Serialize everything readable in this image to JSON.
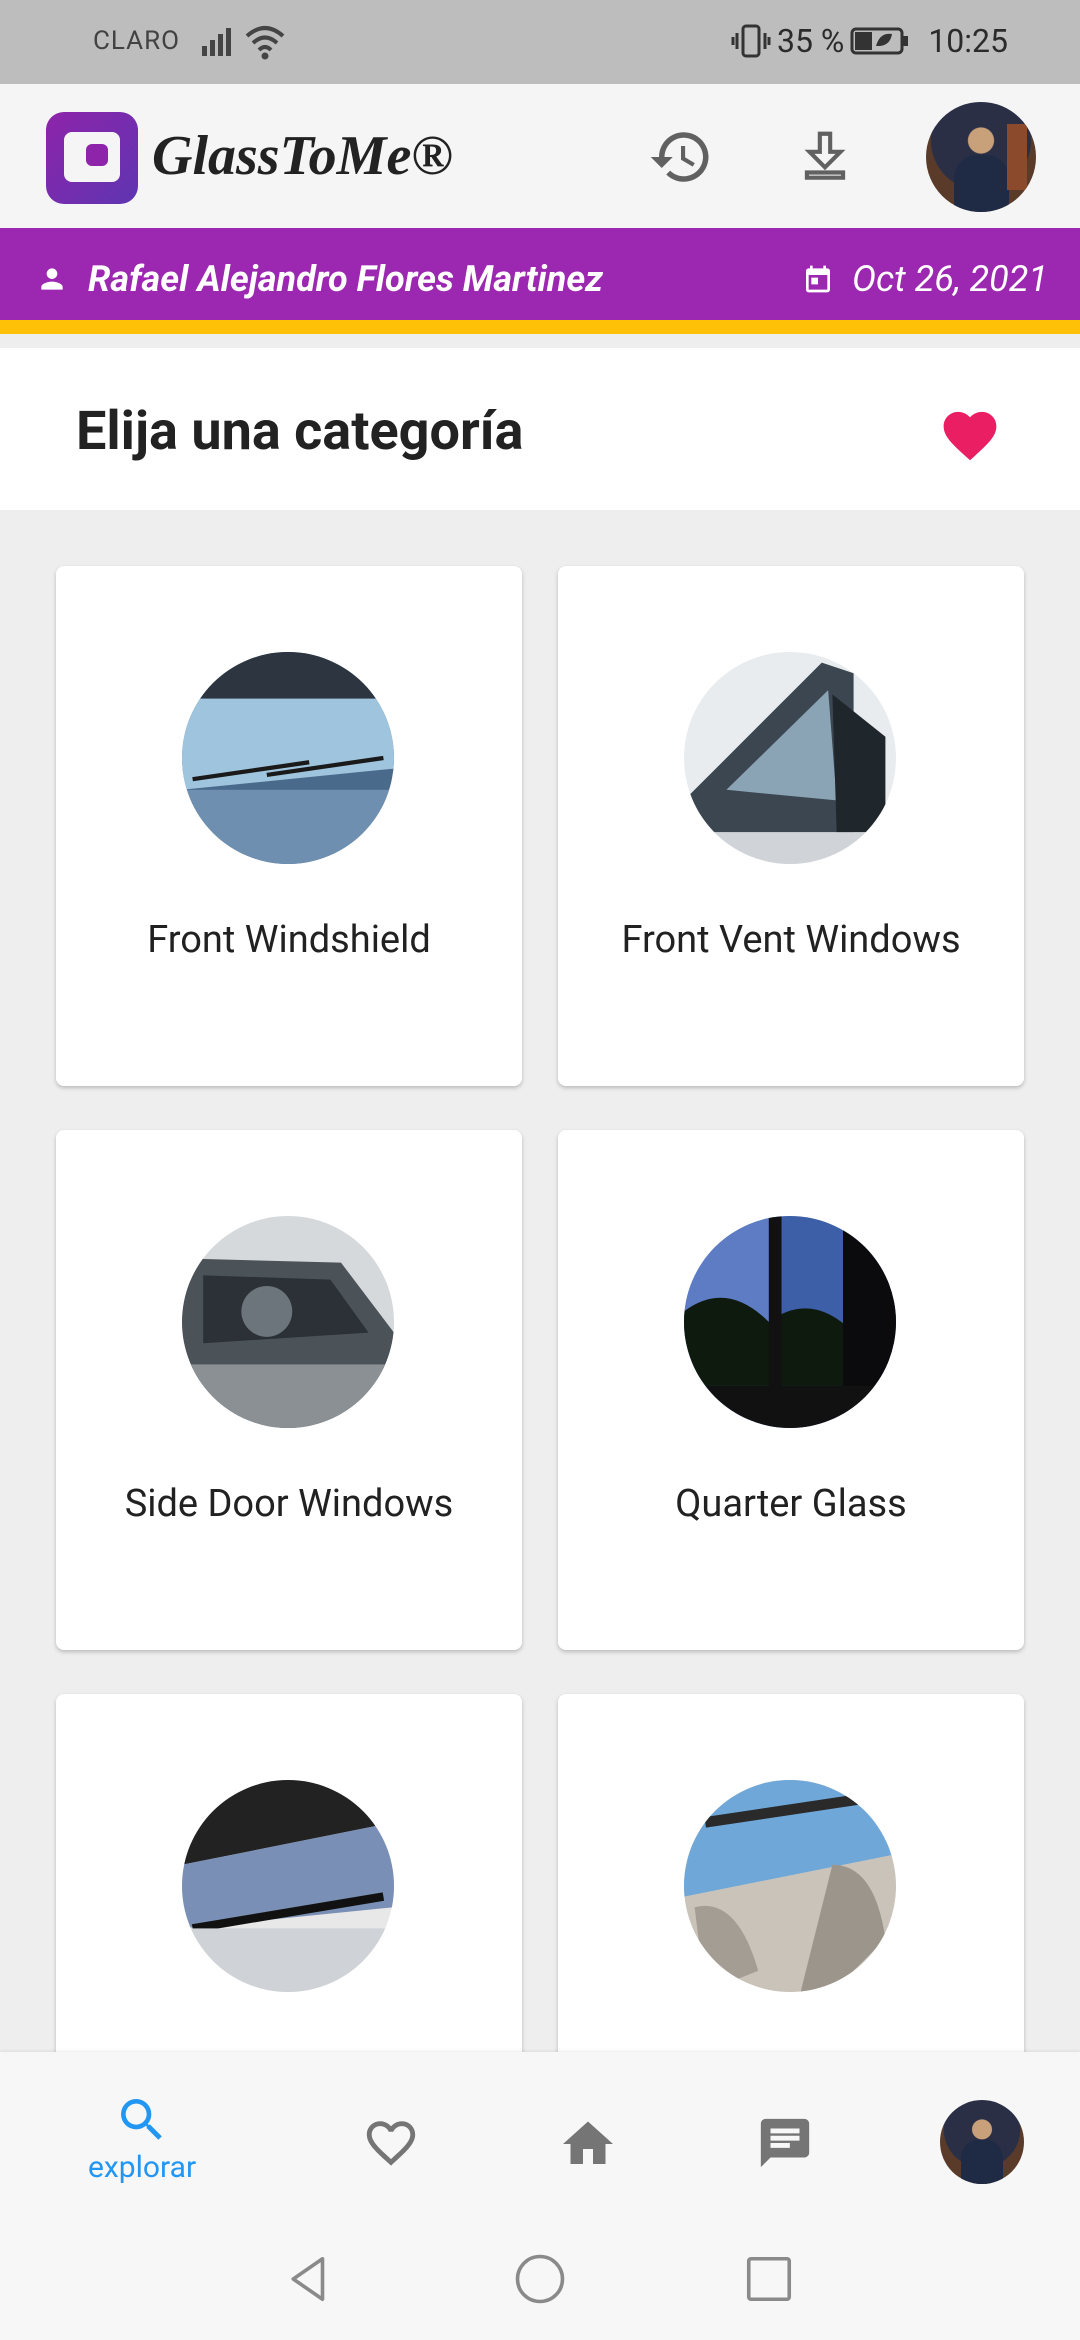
{
  "status_bar": {
    "carrier": "CLARO",
    "battery": "35 %",
    "time": "10:25"
  },
  "app_bar": {
    "brand": "GlassToMe®",
    "icons": [
      "history-icon",
      "download-icon",
      "profile-avatar"
    ]
  },
  "banner": {
    "user_name": "Rafael Alejandro Flores Martinez",
    "date": "Oct 26, 2021",
    "colors": {
      "background": "#9c27b0",
      "accent": "#ffc107"
    }
  },
  "section": {
    "title": "Elija una categoría",
    "favorite_color": "#e91e63"
  },
  "categories": [
    {
      "label": "Front Windshield"
    },
    {
      "label": "Front Vent Windows"
    },
    {
      "label": "Side Door Windows"
    },
    {
      "label": "Quarter Glass"
    },
    {
      "label": ""
    },
    {
      "label": ""
    }
  ],
  "bottom_nav": {
    "items": [
      {
        "icon": "search-icon",
        "label": "explorar",
        "active": true
      },
      {
        "icon": "heart-outline-icon",
        "label": ""
      },
      {
        "icon": "home-icon",
        "label": ""
      },
      {
        "icon": "chat-icon",
        "label": ""
      },
      {
        "icon": "profile-avatar",
        "label": ""
      }
    ],
    "active_color": "#2196f3"
  }
}
